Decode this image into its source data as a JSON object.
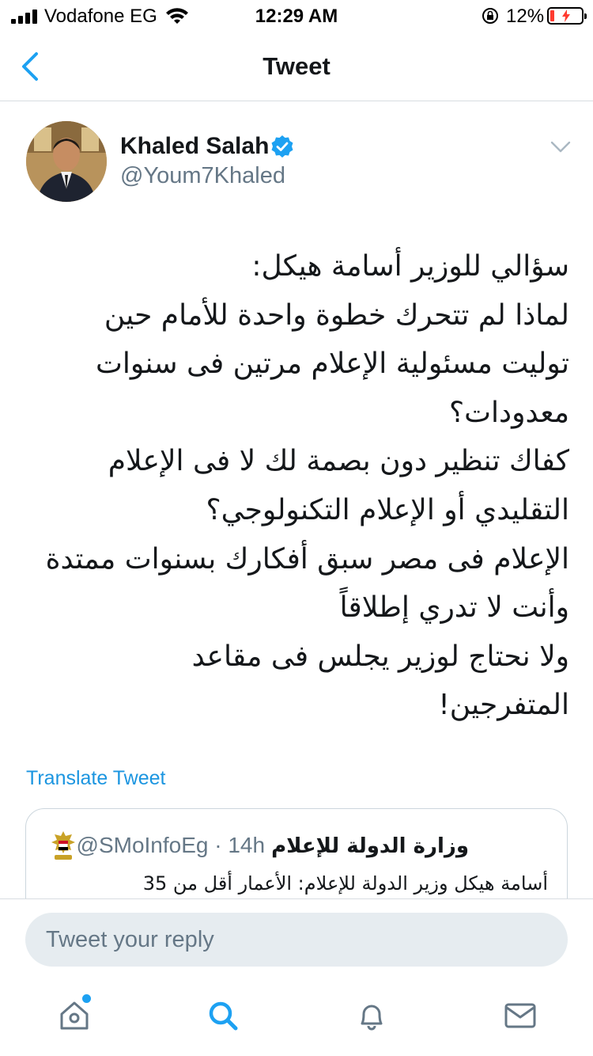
{
  "status_bar": {
    "carrier": "Vodafone EG",
    "time": "12:29 AM",
    "battery_percent": "12%",
    "battery_level": 0.12,
    "battery_color": "#ff3b30"
  },
  "nav": {
    "title": "Tweet",
    "back_icon": "chevron-left-icon"
  },
  "tweet": {
    "author_name": "Khaled Salah",
    "author_handle": "@Youm7Khaled",
    "verified": true,
    "lines": [
      "سؤالي للوزير أسامة هيكل:",
      "لماذا لم تتحرك خطوة واحدة للأمام حين",
      "توليت مسئولية الإعلام مرتين فى سنوات",
      "معدودات؟",
      "كفاك تنظير دون بصمة لك لا فى الإعلام",
      "التقليدي أو الإعلام التكنولوجي؟",
      "الإعلام فى مصر سبق أفكارك بسنوات ممتدة",
      "وأنت لا تدري إطلاقاً",
      "ولا نحتاج لوزير يجلس فى مقاعد",
      "المتفرجين!"
    ],
    "translate_label": "Translate Tweet"
  },
  "quoted_tweet": {
    "name": "وزارة الدولة للإعلام",
    "handle_time": "@SMoInfoEg · 14h",
    "text": "أسامة هيكل وزير الدولة للإعلام: الأعمار أقل من 35"
  },
  "reply": {
    "placeholder": "Tweet your reply"
  },
  "tab_bar": {
    "items": [
      "home-icon",
      "search-icon",
      "notifications-icon",
      "messages-icon"
    ],
    "active": "search-icon"
  },
  "colors": {
    "accent": "#1da1f2",
    "link": "#1b95e0",
    "secondary_text": "#657786",
    "reply_bg": "#e6ecf0"
  }
}
